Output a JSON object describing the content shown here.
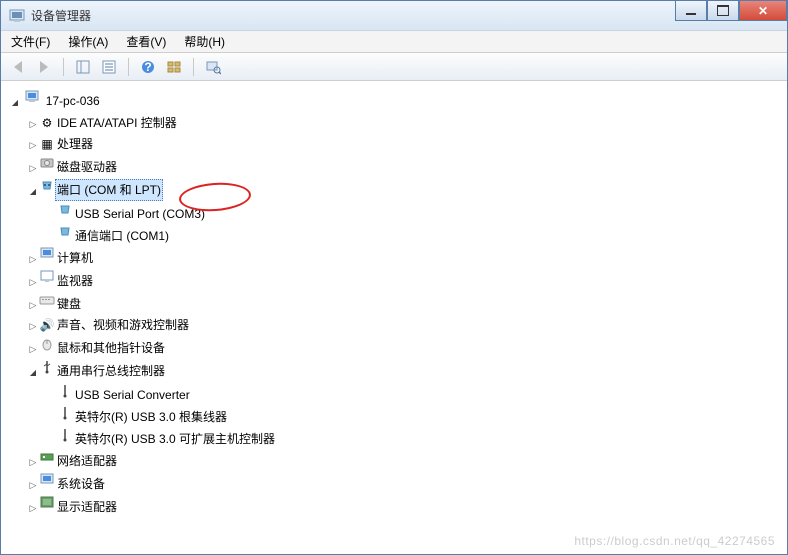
{
  "window": {
    "title": "设备管理器"
  },
  "menu": {
    "file": "文件(F)",
    "action": "操作(A)",
    "view": "查看(V)",
    "help": "帮助(H)"
  },
  "root": {
    "name": "17-pc-036"
  },
  "categories": {
    "ide": "IDE ATA/ATAPI 控制器",
    "cpu": "处理器",
    "disk": "磁盘驱动器",
    "ports": "端口 (COM 和 LPT)",
    "computer": "计算机",
    "monitor": "监视器",
    "keyboard": "键盘",
    "sound": "声音、视频和游戏控制器",
    "mouse": "鼠标和其他指针设备",
    "usb": "通用串行总线控制器",
    "network": "网络适配器",
    "system": "系统设备",
    "display": "显示适配器"
  },
  "ports_children": {
    "item0": "USB Serial Port (COM3)",
    "item1": "通信端口 (COM1)"
  },
  "usb_children": {
    "item0": "USB Serial Converter",
    "item1": "英特尔(R) USB 3.0 根集线器",
    "item2": "英特尔(R) USB 3.0 可扩展主机控制器"
  },
  "watermark": "https://blog.csdn.net/qq_42274565"
}
